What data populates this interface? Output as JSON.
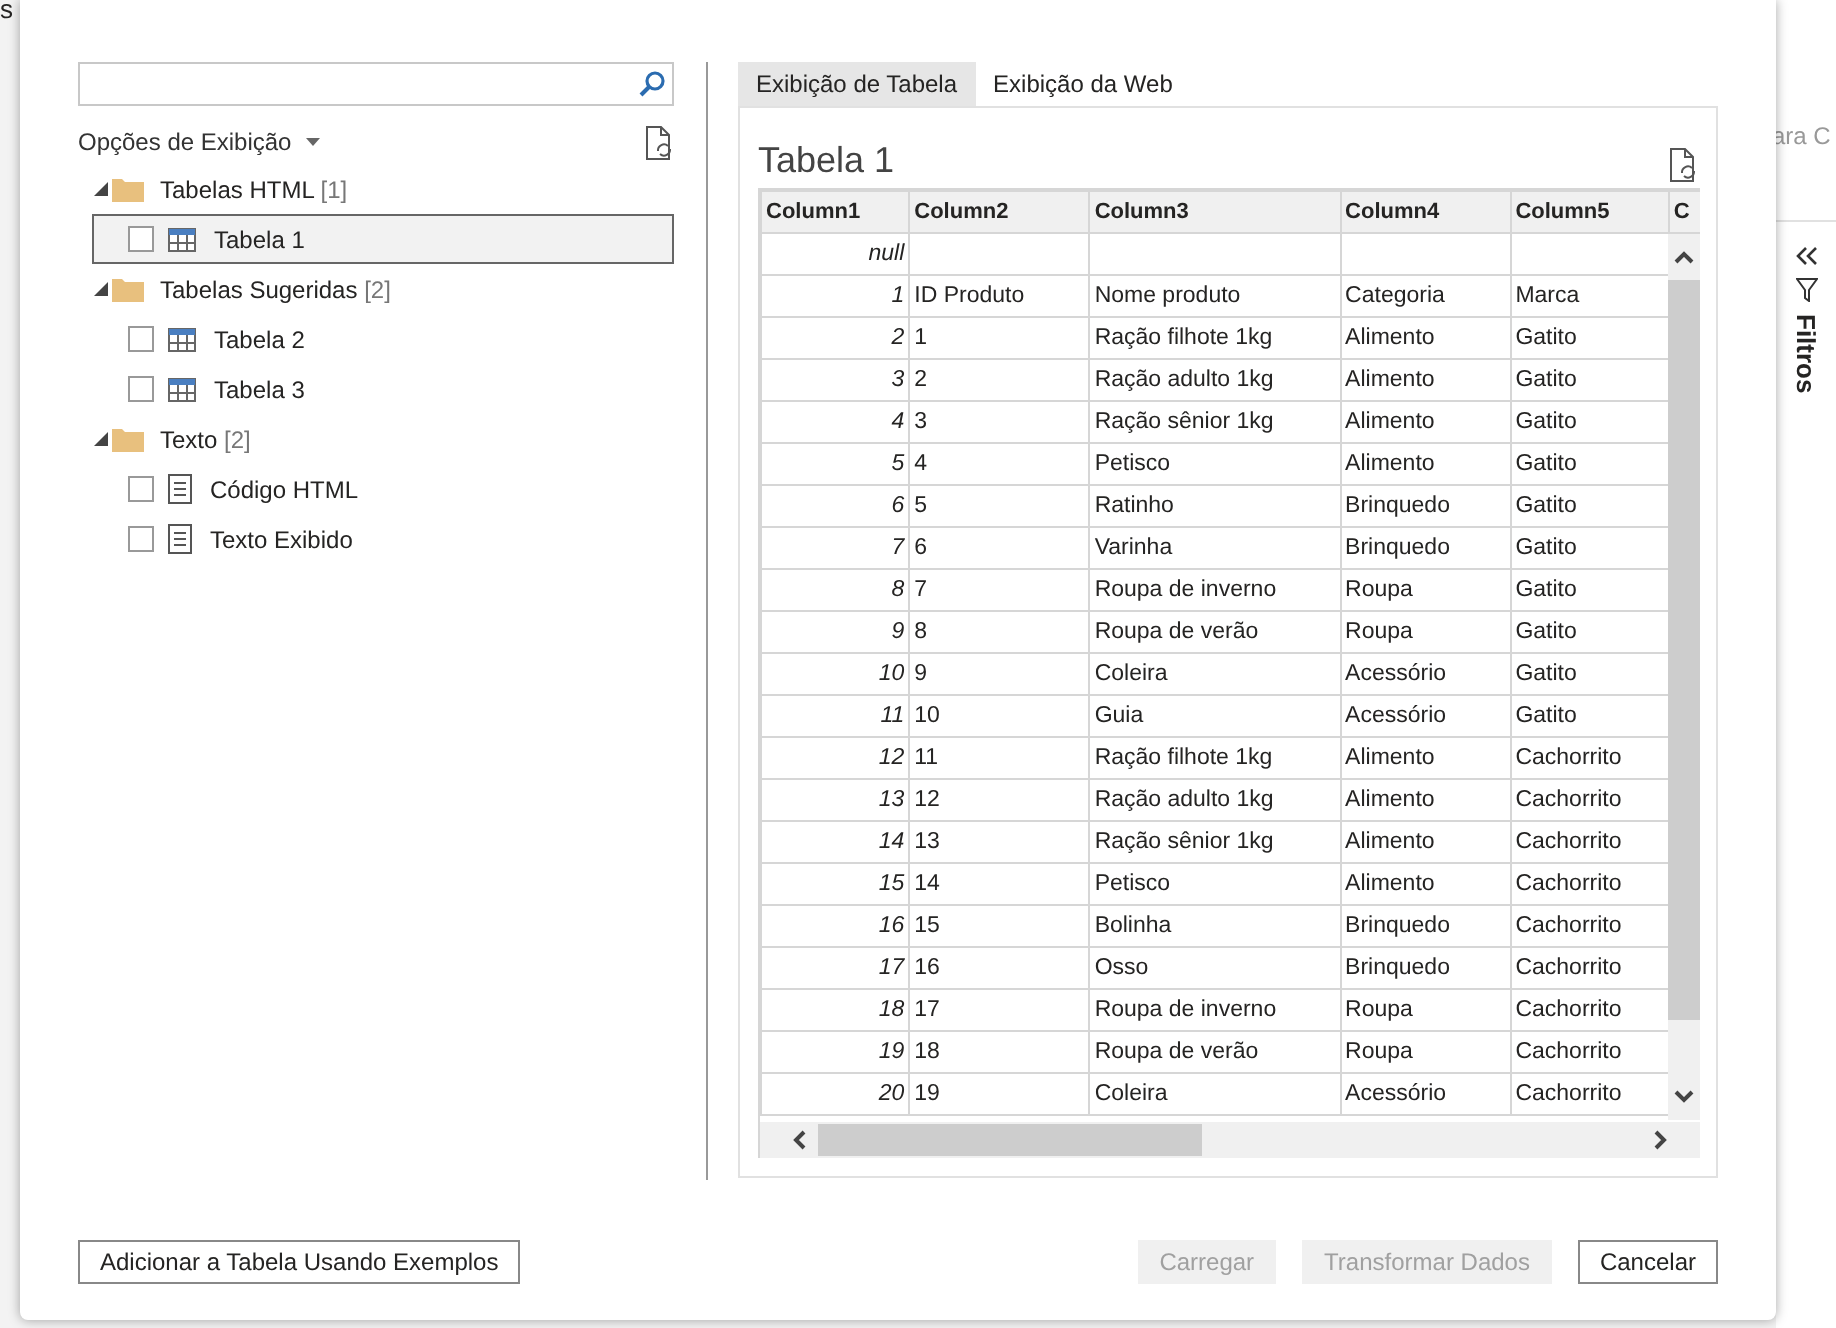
{
  "background": {
    "left_fragment": "s",
    "right_fragment": "ara C",
    "filters_pane": {
      "label": "Filtros"
    }
  },
  "navigator": {
    "options_label": "Opções de Exibição",
    "tree": [
      {
        "label": "Tabelas HTML",
        "count": "[1]",
        "expanded": true,
        "children": [
          {
            "label": "Tabela 1",
            "kind": "table",
            "checked": false,
            "selected": true
          }
        ]
      },
      {
        "label": "Tabelas Sugeridas",
        "count": "[2]",
        "expanded": true,
        "children": [
          {
            "label": "Tabela 2",
            "kind": "table",
            "checked": false,
            "selected": false
          },
          {
            "label": "Tabela 3",
            "kind": "table",
            "checked": false,
            "selected": false
          }
        ]
      },
      {
        "label": "Texto",
        "count": "[2]",
        "expanded": true,
        "children": [
          {
            "label": "Código HTML",
            "kind": "text",
            "checked": false,
            "selected": false
          },
          {
            "label": "Texto Exibido",
            "kind": "text",
            "checked": false,
            "selected": false
          }
        ]
      }
    ]
  },
  "preview": {
    "tabs": [
      {
        "label": "Exibição de Tabela",
        "selected": true
      },
      {
        "label": "Exibição da Web",
        "selected": false
      }
    ],
    "title": "Tabela 1",
    "table": {
      "columns": [
        "Column1",
        "Column2",
        "Column3",
        "Column4",
        "Column5",
        "C"
      ],
      "rows": [
        [
          "null",
          "",
          "",
          "",
          ""
        ],
        [
          "1",
          "ID Produto",
          "Nome produto",
          "Categoria",
          "Marca"
        ],
        [
          "2",
          "1",
          "Ração filhote 1kg",
          "Alimento",
          "Gatito"
        ],
        [
          "3",
          "2",
          "Ração adulto 1kg",
          "Alimento",
          "Gatito"
        ],
        [
          "4",
          "3",
          "Ração sênior 1kg",
          "Alimento",
          "Gatito"
        ],
        [
          "5",
          "4",
          "Petisco",
          "Alimento",
          "Gatito"
        ],
        [
          "6",
          "5",
          "Ratinho",
          "Brinquedo",
          "Gatito"
        ],
        [
          "7",
          "6",
          "Varinha",
          "Brinquedo",
          "Gatito"
        ],
        [
          "8",
          "7",
          "Roupa de inverno",
          "Roupa",
          "Gatito"
        ],
        [
          "9",
          "8",
          "Roupa de verão",
          "Roupa",
          "Gatito"
        ],
        [
          "10",
          "9",
          "Coleira",
          "Acessório",
          "Gatito"
        ],
        [
          "11",
          "10",
          "Guia",
          "Acessório",
          "Gatito"
        ],
        [
          "12",
          "11",
          "Ração filhote 1kg",
          "Alimento",
          "Cachorrito"
        ],
        [
          "13",
          "12",
          "Ração adulto 1kg",
          "Alimento",
          "Cachorrito"
        ],
        [
          "14",
          "13",
          "Ração sênior 1kg",
          "Alimento",
          "Cachorrito"
        ],
        [
          "15",
          "14",
          "Petisco",
          "Alimento",
          "Cachorrito"
        ],
        [
          "16",
          "15",
          "Bolinha",
          "Brinquedo",
          "Cachorrito"
        ],
        [
          "17",
          "16",
          "Osso",
          "Brinquedo",
          "Cachorrito"
        ],
        [
          "18",
          "17",
          "Roupa de inverno",
          "Roupa",
          "Cachorrito"
        ],
        [
          "19",
          "18",
          "Roupa de verão",
          "Roupa",
          "Cachorrito"
        ],
        [
          "20",
          "19",
          "Coleira",
          "Acessório",
          "Cachorrito"
        ]
      ]
    }
  },
  "buttons": [
    {
      "label": "Adicionar a Tabela Usando Exemplos",
      "disabled": false,
      "kind": "left"
    },
    {
      "label": "Carregar",
      "disabled": true,
      "kind": "right"
    },
    {
      "label": "Transformar Dados",
      "disabled": true,
      "kind": "right"
    },
    {
      "label": "Cancelar",
      "disabled": false,
      "kind": "right"
    }
  ]
}
